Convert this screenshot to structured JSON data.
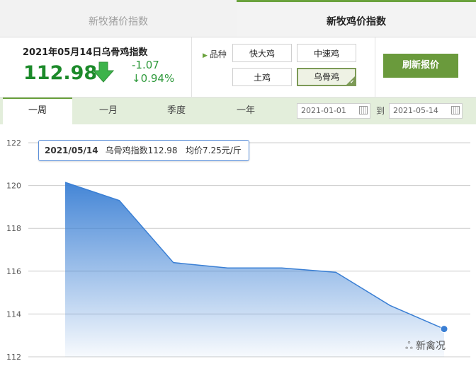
{
  "tabs": {
    "pig": "新牧猪价指数",
    "chicken": "新牧鸡价指数"
  },
  "index": {
    "title": "2021年05月14日乌骨鸡指数",
    "value": "112.98",
    "change": "-1.07",
    "percent": "↓0.94%"
  },
  "breed": {
    "label": "品种",
    "options": [
      "快大鸡",
      "中速鸡",
      "土鸡",
      "乌骨鸡"
    ],
    "selected": "乌骨鸡"
  },
  "refresh_label": "刷新报价",
  "ranges": [
    "一周",
    "一月",
    "季度",
    "一年"
  ],
  "active_range": "一周",
  "date_from": "2021-01-01",
  "date_to_label": "到",
  "date_to": "2021-05-14",
  "tooltip": {
    "date": "2021/05/14",
    "index_text": "乌骨鸡指数112.98",
    "price_text": "均价7.25元/斤"
  },
  "watermark": "新禽况",
  "colors": {
    "accent": "#6aa23c",
    "line": "#3a7fd4",
    "index_green": "#1c8a2a"
  },
  "chart_data": {
    "type": "area",
    "y_ticks": [
      122,
      120,
      118,
      116,
      114,
      112
    ],
    "ylim": [
      112,
      122
    ],
    "values": [
      120.15,
      119.3,
      116.4,
      116.15,
      116.15,
      115.95,
      114.4,
      113.3
    ],
    "highlight_index": 7,
    "grid": true,
    "xlabel": "",
    "ylabel": ""
  }
}
